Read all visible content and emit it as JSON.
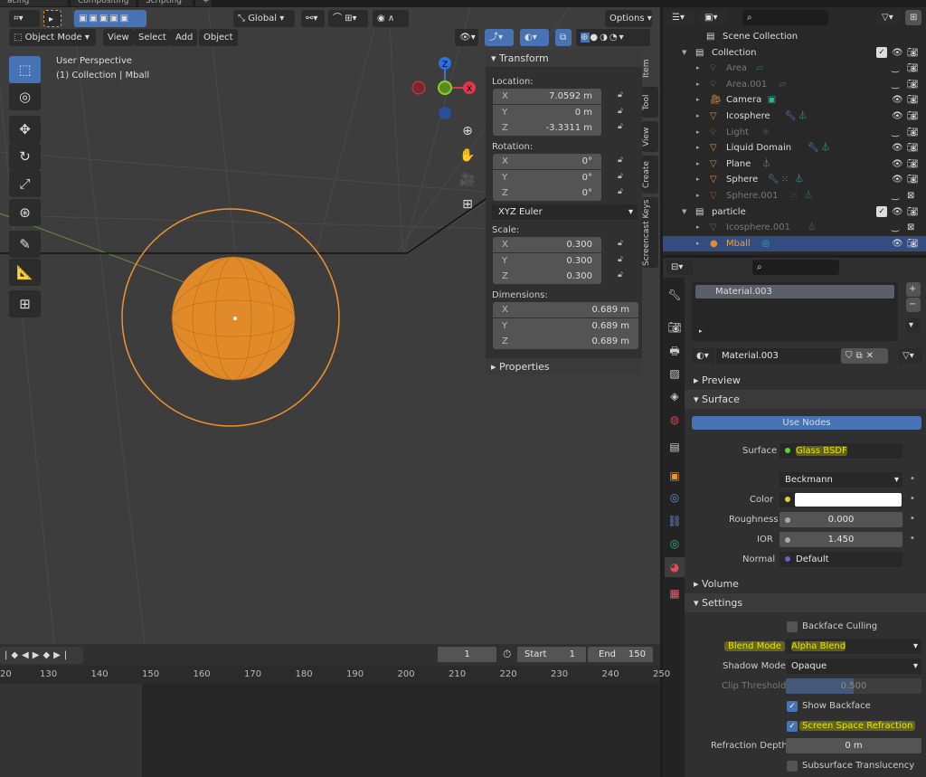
{
  "workspace_tabs": [
    "acing",
    "Compositing",
    "Scripting",
    "+"
  ],
  "viewport": {
    "header": {
      "orientation": "Global",
      "options": "Options",
      "mode": "Object Mode",
      "menus": [
        "View",
        "Select",
        "Add",
        "Object"
      ]
    },
    "overlay_text": {
      "perspective": "User Perspective",
      "collection": "(1) Collection | Mball"
    },
    "gizmo": {
      "z": "Z",
      "x": "X"
    },
    "tools": [
      "select-box",
      "cursor",
      "move",
      "rotate",
      "scale",
      "transform",
      "annotate",
      "measure",
      "add-cube"
    ],
    "nav": [
      "zoom",
      "pan",
      "camera",
      "grid"
    ]
  },
  "npanel": {
    "title": "Transform",
    "location_label": "Location:",
    "location": [
      {
        "axis": "X",
        "value": "7.0592 m"
      },
      {
        "axis": "Y",
        "value": "0 m"
      },
      {
        "axis": "Z",
        "value": "-3.3311 m"
      }
    ],
    "rotation_label": "Rotation:",
    "rotation": [
      {
        "axis": "X",
        "value": "0°"
      },
      {
        "axis": "Y",
        "value": "0°"
      },
      {
        "axis": "Z",
        "value": "0°"
      }
    ],
    "rotation_mode": "XYZ Euler",
    "scale_label": "Scale:",
    "scale": [
      {
        "axis": "X",
        "value": "0.300"
      },
      {
        "axis": "Y",
        "value": "0.300"
      },
      {
        "axis": "Z",
        "value": "0.300"
      }
    ],
    "dimensions_label": "Dimensions:",
    "dimensions": [
      {
        "axis": "X",
        "value": "0.689 m"
      },
      {
        "axis": "Y",
        "value": "0.689 m"
      },
      {
        "axis": "Z",
        "value": "0.689 m"
      }
    ],
    "properties": "Properties",
    "tabs": [
      "Item",
      "Tool",
      "View",
      "Create",
      "Screencast Keys"
    ]
  },
  "outliner": {
    "rows": [
      {
        "name": "Scene Collection",
        "type": "scene",
        "indent": 0
      },
      {
        "name": "Collection",
        "type": "collection",
        "indent": 1,
        "expanded": true,
        "checked": true
      },
      {
        "name": "Area",
        "type": "light",
        "indent": 2,
        "hidden": true,
        "extras": [
          "area-data"
        ]
      },
      {
        "name": "Area.001",
        "type": "light",
        "indent": 2,
        "hidden": true,
        "extras": [
          "area-data"
        ]
      },
      {
        "name": "Camera",
        "type": "camera",
        "indent": 2,
        "extras": [
          "camera-data"
        ]
      },
      {
        "name": "Icosphere",
        "type": "mesh",
        "indent": 2,
        "extras": [
          "modifier",
          "mesh-data"
        ]
      },
      {
        "name": "Light",
        "type": "light",
        "indent": 2,
        "hidden": true,
        "extras": [
          "sun-data"
        ]
      },
      {
        "name": "Liquid Domain",
        "type": "mesh",
        "indent": 2,
        "extras": [
          "modifier",
          "mesh-data"
        ]
      },
      {
        "name": "Plane",
        "type": "mesh",
        "indent": 2,
        "extras": [
          "mesh-data"
        ]
      },
      {
        "name": "Sphere",
        "type": "mesh",
        "indent": 2,
        "extras": [
          "modifier",
          "particles",
          "mesh-data"
        ]
      },
      {
        "name": "Sphere.001",
        "type": "mesh",
        "indent": 2,
        "hidden": true,
        "render_off": true,
        "extras": [
          "particles",
          "mesh-data"
        ]
      },
      {
        "name": "particle",
        "type": "collection",
        "indent": 1,
        "expanded": true,
        "checked": true
      },
      {
        "name": "Icosphere.001",
        "type": "mesh",
        "indent": 2,
        "hidden": true,
        "render_off": true,
        "extras": [
          "mesh-data"
        ]
      },
      {
        "name": "Mball",
        "type": "metaball",
        "indent": 2,
        "selected": true,
        "extras": [
          "metaball-data"
        ]
      }
    ]
  },
  "properties": {
    "slot": "Material.003",
    "material": "Material.003",
    "sections": {
      "preview": "Preview",
      "surface": "Surface",
      "volume": "Volume",
      "settings": "Settings"
    },
    "use_nodes": "Use Nodes",
    "surface": {
      "label": "Surface",
      "value": "Glass BSDF"
    },
    "distribution": "Beckmann",
    "color": {
      "label": "Color",
      "value": "#ffffff"
    },
    "roughness": {
      "label": "Roughness",
      "value": "0.000"
    },
    "ior": {
      "label": "IOR",
      "value": "1.450"
    },
    "normal": {
      "label": "Normal",
      "value": "Default"
    },
    "backface_culling": {
      "label": "Backface Culling",
      "checked": false
    },
    "blend_mode": {
      "label": "Blend Mode",
      "value": "Alpha Blend"
    },
    "shadow_mode": {
      "label": "Shadow Mode",
      "value": "Opaque"
    },
    "clip_threshold": {
      "label": "Clip Threshold",
      "value": "0.500",
      "fraction": 0.5
    },
    "show_backface": {
      "label": "Show Backface",
      "checked": true
    },
    "ssr": {
      "label": "Screen Space Refraction",
      "checked": true
    },
    "refraction_depth": {
      "label": "Refraction Depth",
      "value": "0 m"
    },
    "sss": {
      "label": "Subsurface Translucency",
      "checked": false
    },
    "side_tabs": [
      "tool",
      "render",
      "output",
      "view-layer",
      "scene",
      "world",
      "collection",
      "object",
      "modifiers",
      "particles",
      "physics",
      "constraints",
      "data",
      "material",
      "texture"
    ]
  },
  "timeline": {
    "current_frame": "1",
    "start_label": "Start",
    "start": "1",
    "end_label": "End",
    "end": "150",
    "ruler": [
      "20",
      "130",
      "140",
      "150",
      "160",
      "170",
      "180",
      "190",
      "200",
      "210",
      "220",
      "230",
      "240",
      "250"
    ]
  },
  "colors": {
    "accent": "#4772b3",
    "selection": "#f0922e",
    "highlight": "#e6e600"
  }
}
